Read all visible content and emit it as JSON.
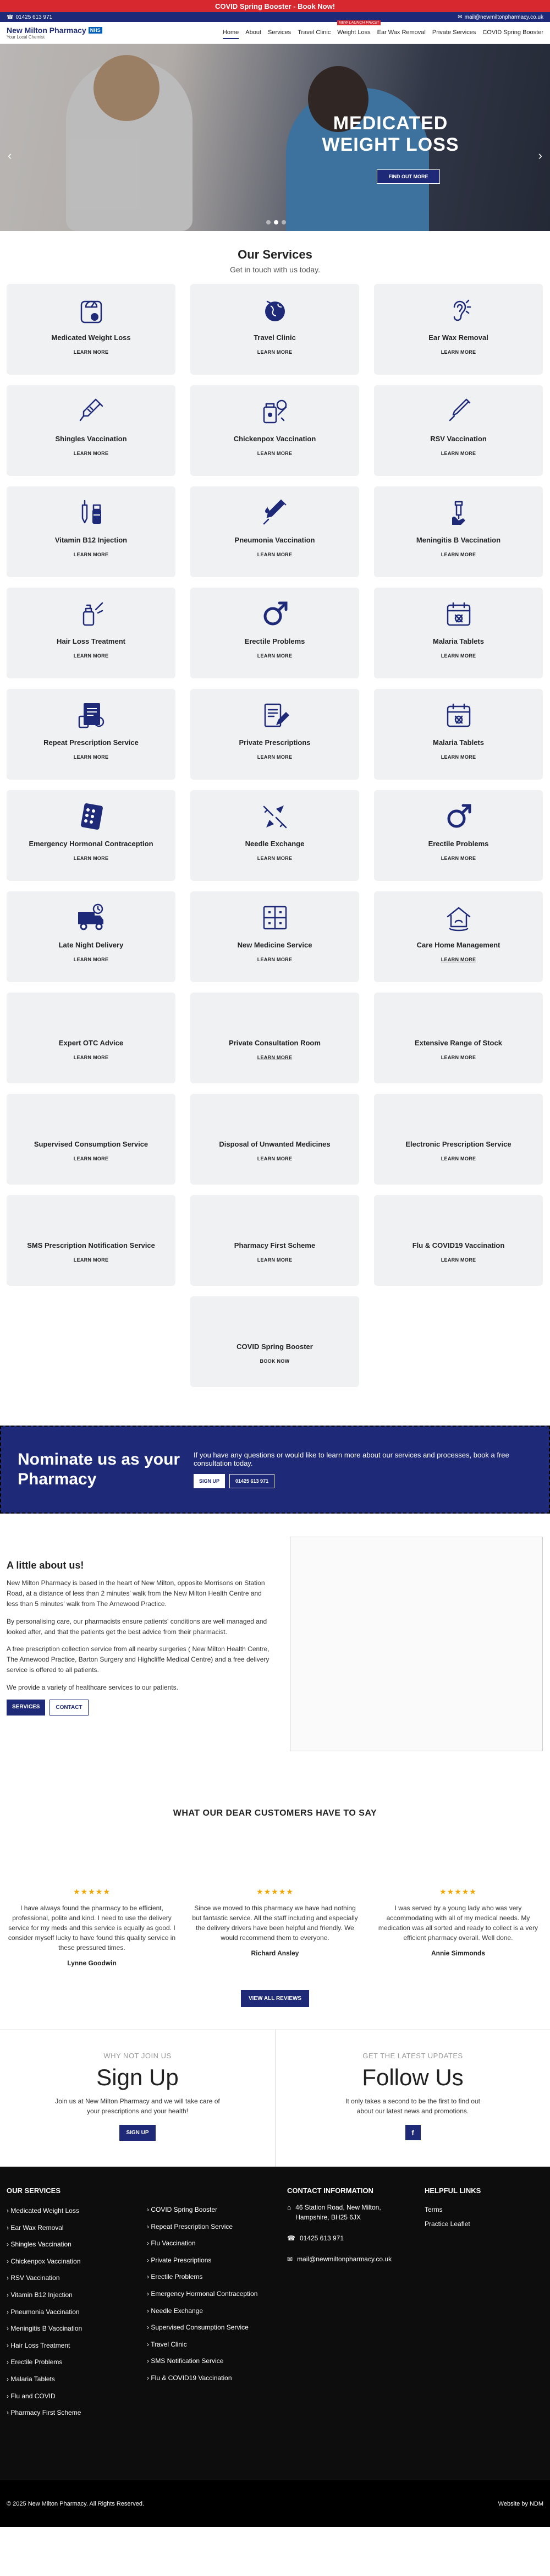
{
  "promo_bar": {
    "text": "COVID Spring Booster - Book Now!"
  },
  "topbar": {
    "phone": "01425 613 971",
    "email": "mail@newmiltonpharmacy.co.uk"
  },
  "logo": {
    "line1": "New Milton Pharmacy",
    "nhs": "NHS",
    "line2": "Your Local Chemist"
  },
  "nav": {
    "items": [
      "Home",
      "About",
      "Services",
      "Travel Clinic",
      "Weight Loss",
      "Ear Wax Removal",
      "Private Services",
      "COVID Spring Booster"
    ],
    "badge": "NEW LAUNCH PRICE!"
  },
  "hero": {
    "title": "MEDICATED WEIGHT LOSS",
    "button": "FIND OUT MORE"
  },
  "services": {
    "title": "Our Services",
    "subtitle": "Get in touch with us today.",
    "cards": [
      {
        "title": "Medicated Weight Loss",
        "link": "LEARN MORE",
        "icon": "scale-icon"
      },
      {
        "title": "Travel Clinic",
        "link": "LEARN MORE",
        "icon": "globe-icon"
      },
      {
        "title": "Ear Wax Removal",
        "link": "LEARN MORE",
        "icon": "ear-icon"
      },
      {
        "title": "Shingles Vaccination",
        "link": "LEARN MORE",
        "icon": "syringe-icon"
      },
      {
        "title": "Chickenpox Vaccination",
        "link": "LEARN MORE",
        "icon": "vaccine-vial-icon"
      },
      {
        "title": "RSV Vaccination",
        "link": "LEARN MORE",
        "icon": "syringe-small-icon"
      },
      {
        "title": "Vitamin B12 Injection",
        "link": "LEARN MORE",
        "icon": "injection-bottle-icon"
      },
      {
        "title": "Pneumonia Vaccination",
        "link": "LEARN MORE",
        "icon": "syringe-drop-icon"
      },
      {
        "title": "Meningitis B Vaccination",
        "link": "LEARN MORE",
        "icon": "hand-syringe-icon"
      },
      {
        "title": "Hair Loss Treatment",
        "link": "LEARN MORE",
        "icon": "hair-bottle-icon"
      },
      {
        "title": "Erectile Problems",
        "link": "LEARN MORE",
        "icon": "male-symbol-icon"
      },
      {
        "title": "Malaria Tablets",
        "link": "LEARN MORE",
        "icon": "calendar-pill-icon"
      },
      {
        "title": "Repeat Prescription Service",
        "link": "LEARN MORE",
        "icon": "prescription-icon"
      },
      {
        "title": "Private Prescriptions",
        "link": "LEARN MORE",
        "icon": "document-pen-icon"
      },
      {
        "title": "Malaria Tablets",
        "link": "LEARN MORE",
        "icon": "calendar-pill-icon"
      },
      {
        "title": "Emergency Hormonal Contraception",
        "link": "LEARN MORE",
        "icon": "pill-pack-icon"
      },
      {
        "title": "Needle Exchange",
        "link": "LEARN MORE",
        "icon": "needle-exchange-icon"
      },
      {
        "title": "Erectile Problems",
        "link": "LEARN MORE",
        "icon": "male-symbol-icon"
      },
      {
        "title": "Late Night Delivery",
        "link": "LEARN MORE",
        "icon": "delivery-truck-icon"
      },
      {
        "title": "New Medicine Service",
        "link": "LEARN MORE",
        "icon": "medicine-cabinet-icon"
      },
      {
        "title": "Care Home Management",
        "link": "LEARN MORE",
        "icon": "care-home-icon"
      },
      {
        "title": "Expert OTC Advice",
        "link": "LEARN MORE",
        "icon": ""
      },
      {
        "title": "Private Consultation Room",
        "link": "LEARN MORE",
        "icon": ""
      },
      {
        "title": "Extensive Range of Stock",
        "link": "LEARN MORE",
        "icon": ""
      },
      {
        "title": "Supervised Consumption Service",
        "link": "LEARN MORE",
        "icon": ""
      },
      {
        "title": "Disposal of Unwanted Medicines",
        "link": "LEARN MORE",
        "icon": ""
      },
      {
        "title": "Electronic Prescription Service",
        "link": "LEARN MORE",
        "icon": ""
      },
      {
        "title": "SMS Prescription Notification Service",
        "link": "LEARN MORE",
        "icon": ""
      },
      {
        "title": "Pharmacy First Scheme",
        "link": "LEARN MORE",
        "icon": ""
      },
      {
        "title": "Flu & COVID19 Vaccination",
        "link": "LEARN MORE",
        "icon": ""
      },
      {
        "title": "COVID Spring Booster",
        "link": "BOOK NOW",
        "icon": ""
      }
    ]
  },
  "nominate": {
    "heading": "Nominate us as your Pharmacy",
    "text": "If you have any questions or would like to learn more about our services and processes, book a free consultation today.",
    "signup": "SIGN UP",
    "phone": "01425 613 971"
  },
  "about": {
    "title": "A little about us!",
    "paragraphs": [
      "New Milton Pharmacy is based in the heart of New Milton, opposite Morrisons on Station Road, at a distance of less than 2 minutes' walk from the New Milton Health Centre and less than 5 minutes' walk from The Arnewood Practice.",
      "By personalising care, our pharmacists ensure patients' conditions are well managed and looked after, and that the patients get the best advice from their pharmacist.",
      "A free prescription collection service from all nearby surgeries ( New Milton Health Centre, The Arnewood Practice, Barton Surgery and Highcliffe Medical Centre) and a free delivery service is offered to all patients.",
      "We provide a variety of healthcare services to our patients."
    ],
    "services_btn": "SERVICES",
    "contact_btn": "CONTACT"
  },
  "reviews": {
    "title": "WHAT OUR DEAR CUSTOMERS HAVE TO SAY",
    "stars": "★★★★★",
    "items": [
      {
        "text": "I have always found the pharmacy to be efficient, professional, polite and kind. I need to use the delivery service for my meds and this service is equally as good. I consider myself lucky to have found this quality service in these pressured times.",
        "name": "Lynne Goodwin"
      },
      {
        "text": "Since we moved to this pharmacy we have had nothing but fantastic service. All the staff including and especially the delivery drivers have been helpful and friendly. We would recommend them to everyone.",
        "name": "Richard Ansley"
      },
      {
        "text": "I was served by a young lady who was very accommodating with all of my medical needs. My medication was all sorted and ready to collect is a very efficient pharmacy overall. Well done.",
        "name": "Annie Simmonds"
      }
    ],
    "view_all": "VIEW ALL REVIEWS"
  },
  "signup": {
    "kicker": "WHY NOT JOIN US",
    "title": "Sign Up",
    "text": "Join us at New Milton Pharmacy and we will take care of your prescriptions and your health!",
    "button": "SIGN UP"
  },
  "follow": {
    "kicker": "GET THE LATEST UPDATES",
    "title": "Follow Us",
    "text": "It only takes a second to be the first to find out about our latest news and promotions.",
    "fb": "f"
  },
  "footer": {
    "services_title": "OUR SERVICES",
    "col1": [
      "Medicated Weight Loss",
      "Ear Wax Removal",
      "Shingles Vaccination",
      "Chickenpox Vaccination",
      "RSV Vaccination",
      "Vitamin B12 Injection",
      "Pneumonia Vaccination",
      "Meningitis B Vaccination",
      "Hair Loss Treatment",
      "Erectile Problems",
      "Malaria Tablets",
      "Flu and COVID",
      "Pharmacy First Scheme"
    ],
    "col2": [
      "COVID Spring Booster",
      "Repeat Prescription Service",
      "Flu Vaccination",
      "Private Prescriptions",
      "Erectile Problems",
      "Emergency Hormonal Contraception",
      "Needle Exchange",
      "Supervised Consumption Service",
      "Travel Clinic",
      "SMS Notification Service",
      "Flu & COVID19 Vaccination"
    ],
    "contact_title": "CONTACT INFORMATION",
    "address": "46 Station Road, New Milton, Hampshire, BH25 6JX",
    "phone": "01425 613 971",
    "email": "mail@newmiltonpharmacy.co.uk",
    "links_title": "HELPFUL LINKS",
    "links": [
      "Terms",
      "Practice Leaflet"
    ]
  },
  "bottom": {
    "copyright": "© 2025 New Milton Pharmacy. All Rights Reserved.",
    "credit": "Website by NDM"
  }
}
